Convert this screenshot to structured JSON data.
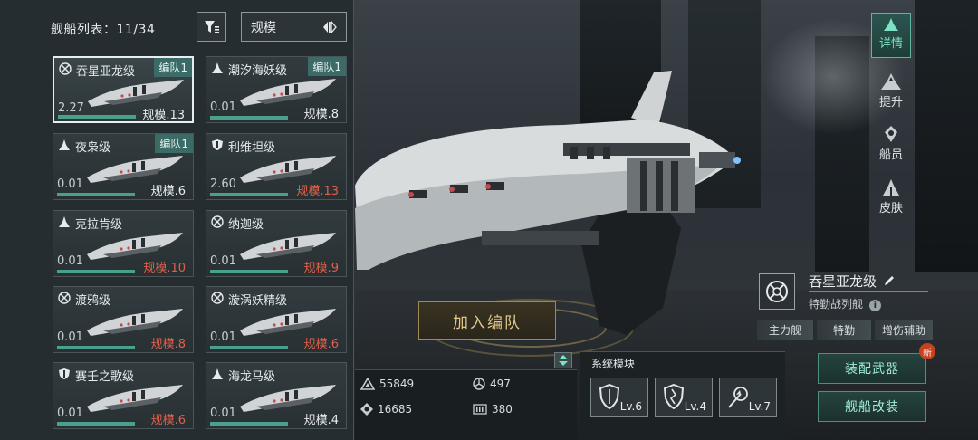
{
  "list": {
    "title": "舰船列表：11/34",
    "sort_value": "规模"
  },
  "cards": [
    {
      "name": "吞星亚龙级",
      "badge": "编队1",
      "cost": "2.27",
      "scale": "规模.13",
      "class_icon": "target-icon",
      "scale_red": false,
      "selected": true
    },
    {
      "name": "潮汐海妖级",
      "badge": "编队1",
      "cost": "0.01",
      "scale": "规模.8",
      "class_icon": "spike-icon",
      "scale_red": false,
      "selected": false
    },
    {
      "name": "夜枭级",
      "badge": "编队1",
      "cost": "0.01",
      "scale": "规模.6",
      "class_icon": "spike-icon",
      "scale_red": false,
      "selected": false
    },
    {
      "name": "利维坦级",
      "badge": "",
      "cost": "2.60",
      "scale": "规模.13",
      "class_icon": "shield-icon",
      "scale_red": true,
      "selected": false
    },
    {
      "name": "克拉肯级",
      "badge": "",
      "cost": "0.01",
      "scale": "规模.10",
      "class_icon": "spike-icon",
      "scale_red": true,
      "selected": false
    },
    {
      "name": "纳迦级",
      "badge": "",
      "cost": "0.01",
      "scale": "规模.9",
      "class_icon": "target-icon",
      "scale_red": true,
      "selected": false
    },
    {
      "name": "渡鸦级",
      "badge": "",
      "cost": "0.01",
      "scale": "规模.8",
      "class_icon": "target-icon",
      "scale_red": true,
      "selected": false
    },
    {
      "name": "漩涡妖精级",
      "badge": "",
      "cost": "0.01",
      "scale": "规模.6",
      "class_icon": "target-icon",
      "scale_red": true,
      "selected": false
    },
    {
      "name": "赛壬之歌级",
      "badge": "",
      "cost": "0.01",
      "scale": "规模.6",
      "class_icon": "shield-icon",
      "scale_red": true,
      "selected": false
    },
    {
      "name": "海龙马级",
      "badge": "",
      "cost": "0.01",
      "scale": "规模.4",
      "class_icon": "spike-icon",
      "scale_red": false,
      "selected": false
    }
  ],
  "nav": {
    "details": "详情",
    "upgrade": "提升",
    "crew": "船员",
    "skin": "皮肤"
  },
  "ship": {
    "name": "吞星亚龙级",
    "type": "特勤战列舰",
    "roles": [
      "主力舰",
      "特勤",
      "增伤辅助"
    ]
  },
  "add_to_fleet": "加入编队",
  "stats": {
    "hp": "55849",
    "armor": "497",
    "shield": "16685",
    "ammo": "380"
  },
  "system": {
    "title": "系统模块",
    "modules": [
      {
        "icon": "shield-icon",
        "level": "Lv.6"
      },
      {
        "icon": "cracked-shield-icon",
        "level": "Lv.4"
      },
      {
        "icon": "target-arrow-icon",
        "level": "Lv.7"
      }
    ]
  },
  "actions": {
    "equip_weapon": "装配武器",
    "modify_ship": "舰船改装",
    "new_badge": "新"
  },
  "colors": {
    "accent": "#7ee3c6",
    "warning": "#e0604a",
    "gold": "#e0c98a"
  }
}
